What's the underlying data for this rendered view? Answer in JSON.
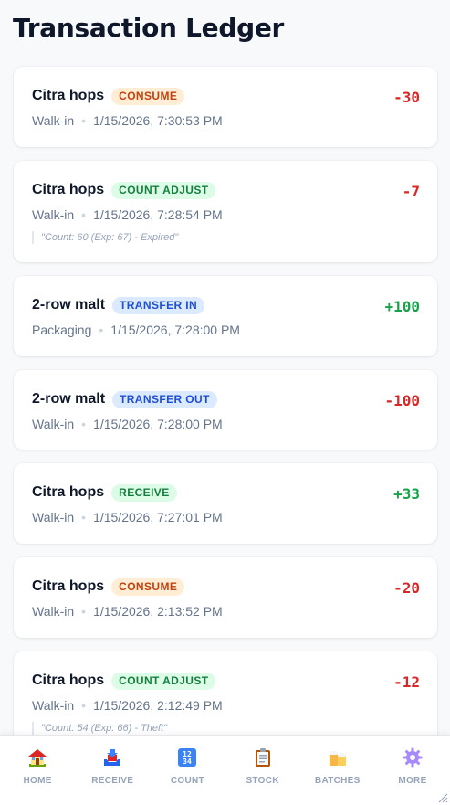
{
  "page": {
    "title": "Transaction Ledger"
  },
  "colors": {
    "negative": "#dc2626",
    "positive": "#16a34a",
    "consume_bg": "#ffedd5",
    "consume_fg": "#c2410c",
    "count_bg": "#dcfce7",
    "count_fg": "#15803d",
    "transfer_bg": "#dbeafe",
    "transfer_fg": "#1d4ed8",
    "receive_bg": "#dcfce7",
    "receive_fg": "#15803d"
  },
  "transactions": [
    {
      "item": "Citra hops",
      "type": "CONSUME",
      "location": "Walk-in",
      "timestamp": "1/15/2026, 7:30:53 PM",
      "qty": "-30"
    },
    {
      "item": "Citra hops",
      "type": "COUNT ADJUST",
      "location": "Walk-in",
      "timestamp": "1/15/2026, 7:28:54 PM",
      "qty": "-7",
      "note": "\"Count: 60 (Exp: 67) - Expired\""
    },
    {
      "item": "2-row malt",
      "type": "TRANSFER IN",
      "location": "Packaging",
      "timestamp": "1/15/2026, 7:28:00 PM",
      "qty": "+100"
    },
    {
      "item": "2-row malt",
      "type": "TRANSFER OUT",
      "location": "Walk-in",
      "timestamp": "1/15/2026, 7:28:00 PM",
      "qty": "-100"
    },
    {
      "item": "Citra hops",
      "type": "RECEIVE",
      "location": "Walk-in",
      "timestamp": "1/15/2026, 7:27:01 PM",
      "qty": "+33"
    },
    {
      "item": "Citra hops",
      "type": "CONSUME",
      "location": "Walk-in",
      "timestamp": "1/15/2026, 2:13:52 PM",
      "qty": "-20"
    },
    {
      "item": "Citra hops",
      "type": "COUNT ADJUST",
      "location": "Walk-in",
      "timestamp": "1/15/2026, 2:12:49 PM",
      "qty": "-12",
      "note": "\"Count: 54 (Exp: 66) - Theft\""
    }
  ],
  "nav": [
    {
      "label": "HOME",
      "icon": "house-icon"
    },
    {
      "label": "RECEIVE",
      "icon": "inbox-tray-icon"
    },
    {
      "label": "COUNT",
      "icon": "number-keys-icon"
    },
    {
      "label": "STOCK",
      "icon": "clipboard-icon"
    },
    {
      "label": "BATCHES",
      "icon": "beer-mugs-icon"
    },
    {
      "label": "MORE",
      "icon": "gear-icon"
    }
  ]
}
